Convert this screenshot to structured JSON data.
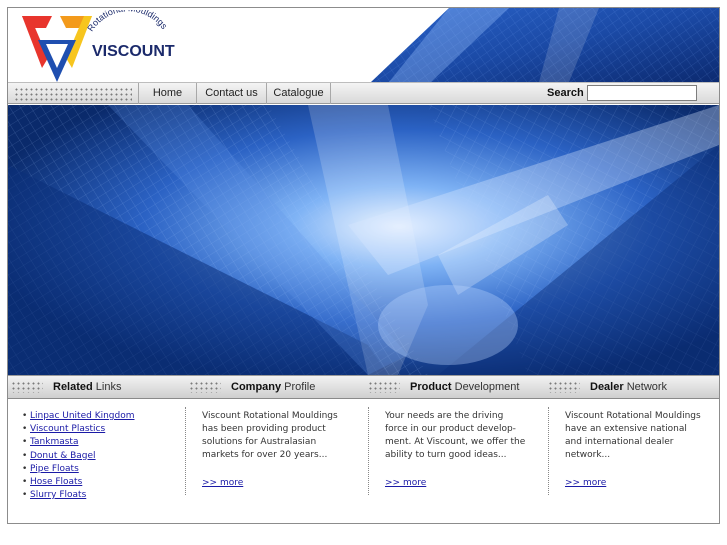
{
  "logo": {
    "brand": "VISCOUNT",
    "tagline": "Rotational Mouldings",
    "colors": {
      "red": "#e8352d",
      "orange": "#f39a1b",
      "yellow": "#f7c51e",
      "blue": "#1f4fb0",
      "text": "#1b2a6b"
    }
  },
  "nav": {
    "items": [
      {
        "label": "Home"
      },
      {
        "label": "Contact us"
      },
      {
        "label": "Catalogue"
      }
    ],
    "search_label": "Search :",
    "search_value": ""
  },
  "sections": [
    {
      "bold": "Related",
      "rest": " Links"
    },
    {
      "bold": "Company",
      "rest": " Profile"
    },
    {
      "bold": "Product",
      "rest": " Development"
    },
    {
      "bold": "Dealer",
      "rest": " Network"
    }
  ],
  "related_links": [
    {
      "label": "Linpac United Kingdom"
    },
    {
      "label": "Viscount Plastics"
    },
    {
      "label": "Tankmasta"
    },
    {
      "label": "Donut & Bagel"
    },
    {
      "label": "Pipe Floats"
    },
    {
      "label": "Hose Floats"
    },
    {
      "label": "Slurry Floats"
    }
  ],
  "bullet": "•",
  "blurbs": [
    {
      "text": "Viscount Rotational Mouldings\nhas been providing product\nsolutions for Australasian\nmarkets for over 20 years...",
      "more": ">> more"
    },
    {
      "text": "Your needs are the driving\nforce in our product develop-\nment. At Viscount, we offer the\nability to turn good ideas...",
      "more": ">> more"
    },
    {
      "text": "Viscount Rotational Mouldings\nhave an extensive national\nand international dealer\nnetwork...",
      "more": ">> more"
    }
  ],
  "theme": {
    "hero_dark": "#0a2a6b",
    "hero_light": "#cfe3ff",
    "link": "#1a1aa6"
  }
}
